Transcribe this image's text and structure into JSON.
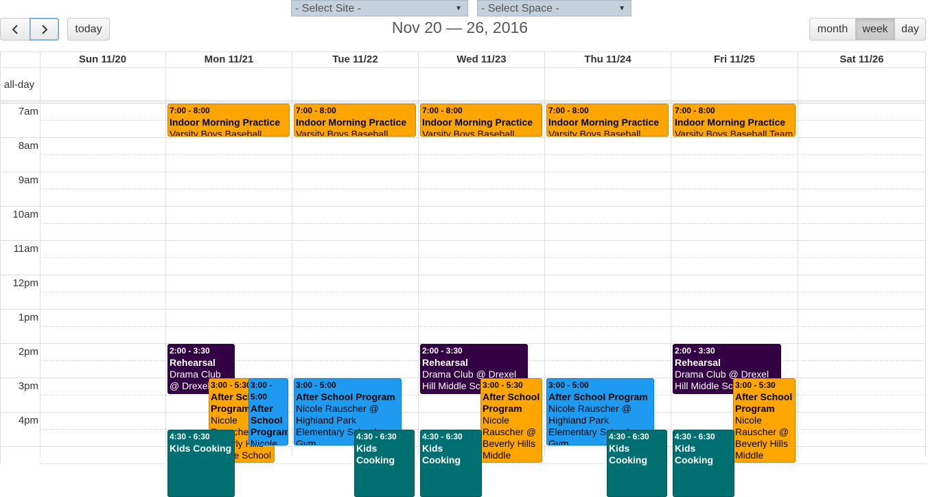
{
  "filters": {
    "site": "- Select Site -",
    "space": "- Select Space -"
  },
  "toolbar": {
    "prev_icon": "chevron-left-icon",
    "next_icon": "chevron-right-icon",
    "today_label": "today",
    "title": "Nov 20 — 26, 2016",
    "views": [
      "month",
      "week",
      "day"
    ],
    "active_view": "week"
  },
  "days": [
    "Sun 11/20",
    "Mon 11/21",
    "Tue 11/22",
    "Wed 11/23",
    "Thu 11/24",
    "Fri 11/25",
    "Sat 11/26"
  ],
  "allday_label": "all-day",
  "times": [
    "7am",
    "8am",
    "9am",
    "10am",
    "11am",
    "12pm",
    "1pm",
    "2pm",
    "3pm",
    "4pm"
  ],
  "events": [
    {
      "day": 1,
      "start": 7,
      "end": 8,
      "color": "orange",
      "time": "7:00 - 8:00",
      "title": "Indoor Morning Practice",
      "desc": "Varsity Boys Baseball Team"
    },
    {
      "day": 2,
      "start": 7,
      "end": 8,
      "color": "orange",
      "time": "7:00 - 8:00",
      "title": "Indoor Morning Practice",
      "desc": "Varsity Boys Baseball Team"
    },
    {
      "day": 3,
      "start": 7,
      "end": 8,
      "color": "orange",
      "time": "7:00 - 8:00",
      "title": "Indoor Morning Practice",
      "desc": "Varsity Boys Baseball Team"
    },
    {
      "day": 4,
      "start": 7,
      "end": 8,
      "color": "orange",
      "time": "7:00 - 8:00",
      "title": "Indoor Morning Practice",
      "desc": "Varsity Boys Baseball Team"
    },
    {
      "day": 5,
      "start": 7,
      "end": 8,
      "color": "orange",
      "time": "7:00 - 8:00",
      "title": "Indoor Morning Practice",
      "desc": "Varsity Boys Baseball Team"
    },
    {
      "day": 1,
      "start": 14,
      "end": 15.5,
      "color": "purple",
      "time": "2:00 - 3:30",
      "title": "Rehearsal",
      "desc": "Drama Club @ Drexel Hill Middle School",
      "lane": 0,
      "lanes": 2
    },
    {
      "day": 3,
      "start": 14,
      "end": 15.5,
      "color": "purple",
      "time": "2:00 - 3:30",
      "title": "Rehearsal",
      "desc": "Drama Club @ Drexel Hill Middle School",
      "lane": 0,
      "lanes": 1,
      "wfrac": 0.88
    },
    {
      "day": 5,
      "start": 14,
      "end": 15.5,
      "color": "purple",
      "time": "2:00 - 3:30",
      "title": "Rehearsal",
      "desc": "Drama Club @ Drexel Hill Middle School",
      "lane": 0,
      "lanes": 1,
      "wfrac": 0.88
    },
    {
      "day": 1,
      "start": 15,
      "end": 17.5,
      "color": "orange",
      "time": "3:00 - 5:30",
      "title": "After School Program",
      "desc": "Nicole Rauscher @ Beverly Hills Middle School",
      "lane": 1,
      "lanes": 3
    },
    {
      "day": 1,
      "start": 15,
      "end": 17,
      "color": "blue",
      "time": "3:00 - 5:00",
      "title": "After School Program",
      "desc": "Nicole Rauscher",
      "lane": 2,
      "lanes": 3
    },
    {
      "day": 2,
      "start": 15,
      "end": 17,
      "color": "blue",
      "time": "3:00 - 5:00",
      "title": "After School Program",
      "desc": "Nicole Rauscher @ Highland Park Elementary School Gym",
      "lane": 0,
      "lanes": 1,
      "wfrac": 0.88
    },
    {
      "day": 3,
      "start": 15,
      "end": 17.5,
      "color": "orange",
      "time": "3:00 - 5:30",
      "title": "After School Program",
      "desc": "Nicole Rauscher @ Beverly Hills Middle School",
      "lane": 1,
      "lanes": 2
    },
    {
      "day": 4,
      "start": 15,
      "end": 17,
      "color": "blue",
      "time": "3:00 - 5:00",
      "title": "After School Program",
      "desc": "Nicole Rauscher @ Highland Park Elementary School Gym",
      "lane": 0,
      "lanes": 1,
      "wfrac": 0.88
    },
    {
      "day": 5,
      "start": 15,
      "end": 17.5,
      "color": "orange",
      "time": "3:00 - 5:30",
      "title": "After School Program",
      "desc": "Nicole Rauscher @ Beverly Hills Middle School",
      "lane": 1,
      "lanes": 2
    },
    {
      "day": 1,
      "start": 16.5,
      "end": 18.5,
      "color": "teal",
      "time": "4:30 - 6:30",
      "title": "Kids Cooking",
      "desc": "",
      "lane": 0,
      "lanes": 3
    },
    {
      "day": 2,
      "start": 16.5,
      "end": 18.5,
      "color": "teal",
      "time": "4:30 - 6:30",
      "title": "Kids Cooking",
      "desc": "",
      "lane": 1,
      "lanes": 2
    },
    {
      "day": 3,
      "start": 16.5,
      "end": 18.5,
      "color": "teal",
      "time": "4:30 - 6:30",
      "title": "Kids Cooking",
      "desc": "",
      "lane": 0,
      "lanes": 2
    },
    {
      "day": 4,
      "start": 16.5,
      "end": 18.5,
      "color": "teal",
      "time": "4:30 - 6:30",
      "title": "Kids Cooking",
      "desc": "",
      "lane": 1,
      "lanes": 2
    },
    {
      "day": 5,
      "start": 16.5,
      "end": 18.5,
      "color": "teal",
      "time": "4:30 - 6:30",
      "title": "Kids Cooking",
      "desc": "",
      "lane": 0,
      "lanes": 2
    }
  ]
}
